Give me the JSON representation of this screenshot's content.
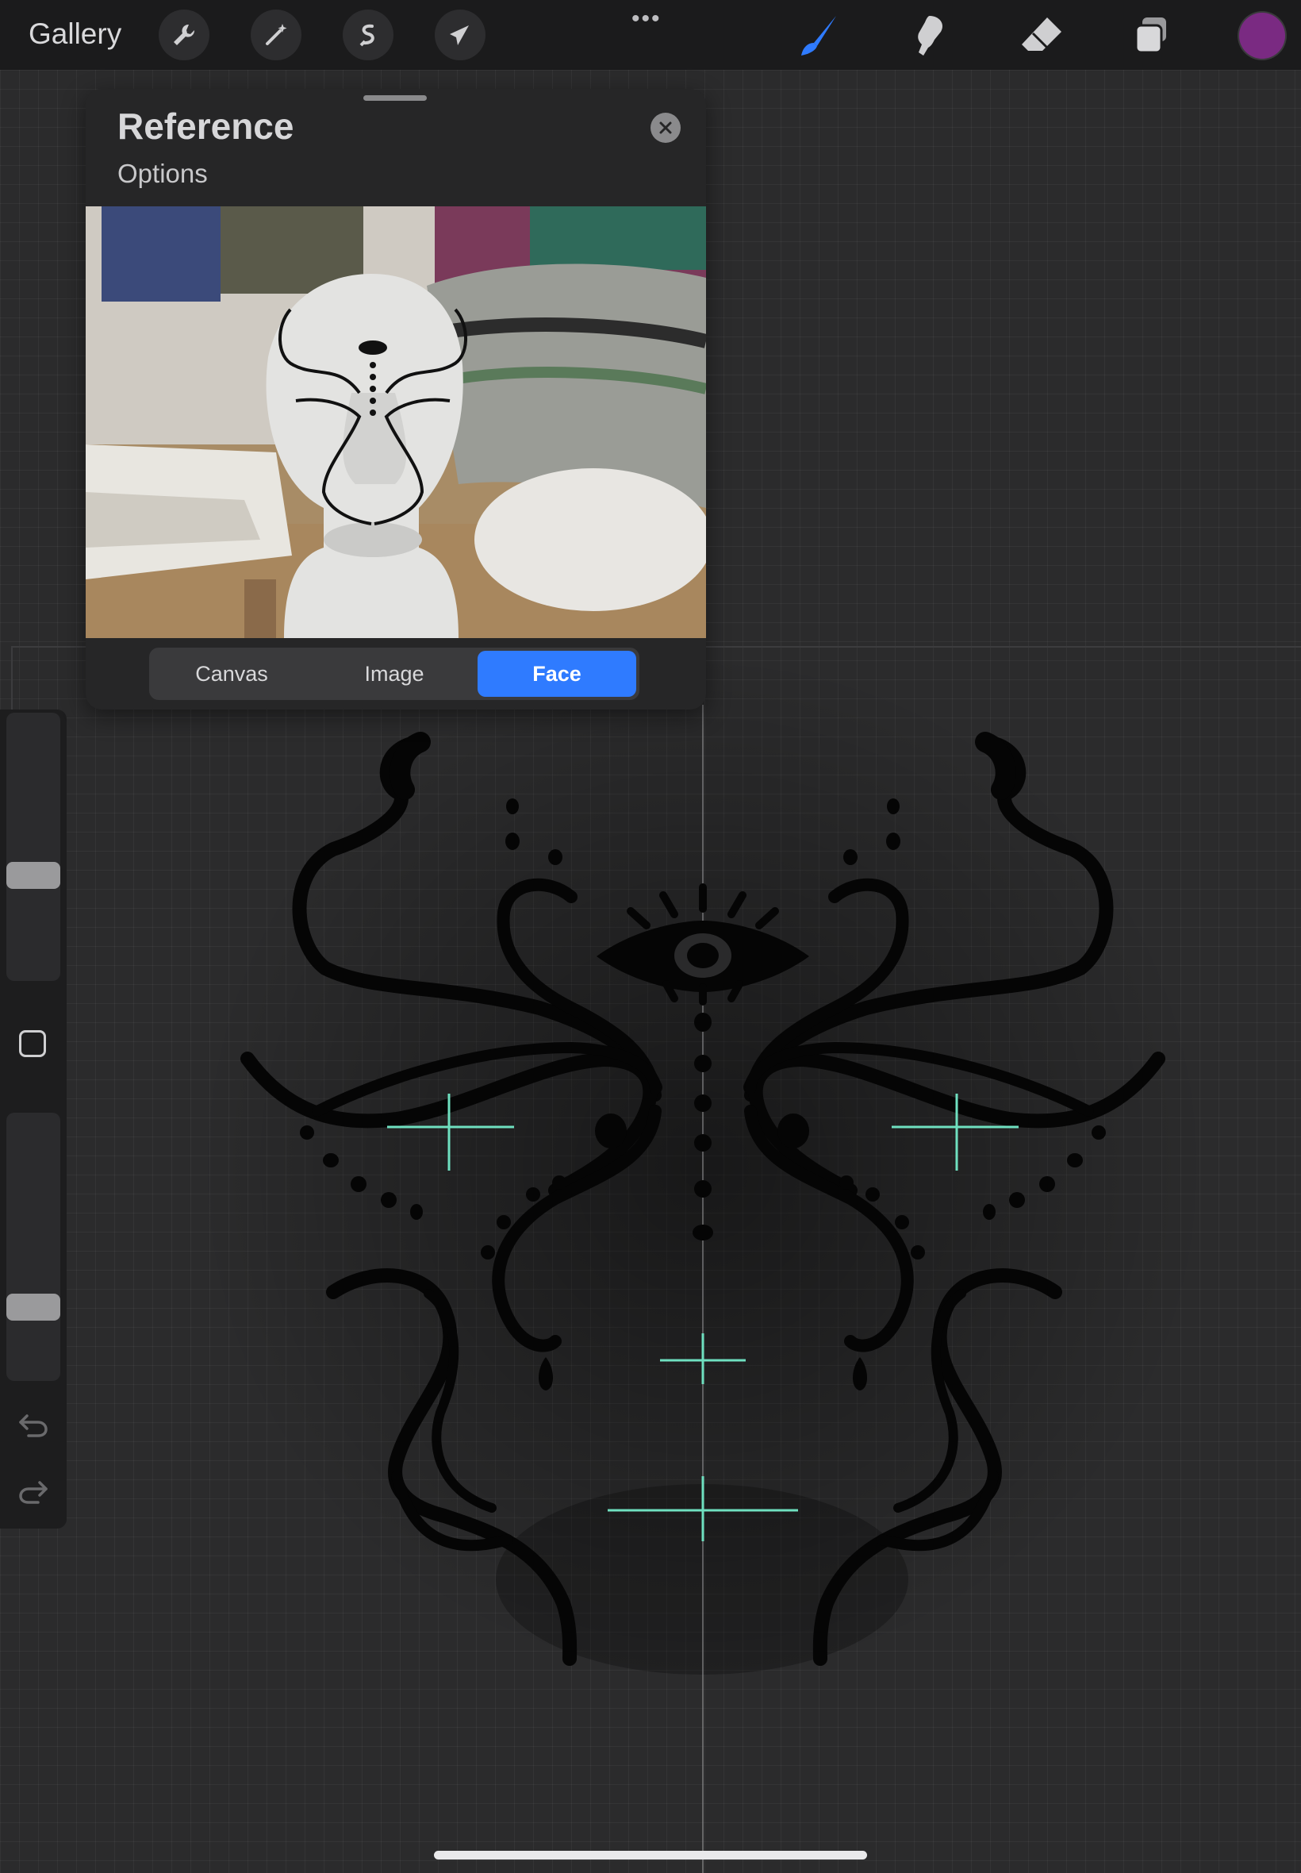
{
  "topbar": {
    "gallery_label": "Gallery",
    "left_tools": [
      "wrench-icon",
      "magic-wand-icon",
      "selection-icon",
      "transform-arrow-icon"
    ],
    "right_tools": [
      "brush-icon",
      "smudge-icon",
      "eraser-icon",
      "layers-icon"
    ],
    "active_tool": "brush-icon",
    "current_color": "#7a2a82",
    "accent_color": "#2f7bff"
  },
  "reference_panel": {
    "title": "Reference",
    "options_label": "Options",
    "tabs": [
      {
        "label": "Canvas",
        "active": false
      },
      {
        "label": "Image",
        "active": false
      },
      {
        "label": "Face",
        "active": true
      }
    ]
  },
  "sidebar": {
    "brush_size_level": 0.62,
    "opacity_level": 0.75,
    "buttons": [
      "modify-button",
      "undo-icon",
      "redo-icon"
    ]
  },
  "canvas": {
    "guide_color": "#6fe0c0",
    "stroke_color": "#050505"
  }
}
